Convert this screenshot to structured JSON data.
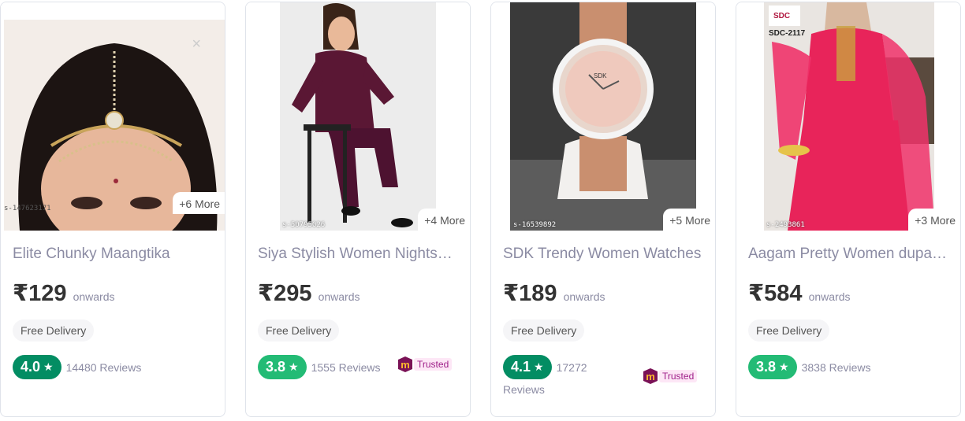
{
  "products": [
    {
      "title": "Elite Chunky Maangtika",
      "price": "₹129",
      "onwards": "onwards",
      "more": "+6 More",
      "sku": "s-147623171",
      "delivery": "Free Delivery",
      "rating": "4.0",
      "reviews": "14480 Reviews",
      "badge_color": "#038d63"
    },
    {
      "title": "Siya Stylish Women Nightsuits",
      "price": "₹295",
      "onwards": "onwards",
      "more": "+4 More",
      "sku": "s-50795026",
      "delivery": "Free Delivery",
      "rating": "3.8",
      "reviews": "1555 Reviews",
      "trusted": "Trusted",
      "badge_color": "#23bb75"
    },
    {
      "title": "SDK Trendy Women Watches",
      "price": "₹189",
      "onwards": "onwards",
      "more": "+5 More",
      "sku": "s-16539892",
      "delivery": "Free Delivery",
      "rating": "4.1",
      "reviews_line1": "17272",
      "reviews_line2": "Reviews",
      "trusted": "Trusted",
      "badge_color": "#038d63"
    },
    {
      "title": "Aagam Pretty Women dupattas",
      "price": "₹584",
      "onwards": "onwards",
      "more": "+3 More",
      "sku": "s-2493861",
      "delivery": "Free Delivery",
      "rating": "3.8",
      "reviews": "3838 Reviews",
      "badge_color": "#23bb75",
      "img_text_brand": "SDC",
      "img_text_code": "SDC-2117"
    }
  ],
  "colors": {
    "title": "#8b8ba3",
    "rating_dark": "#038d63",
    "rating_light": "#23bb75",
    "trusted": "#9f2089"
  },
  "icons": {
    "star": "star-icon",
    "trusted": "meesho-m-icon"
  }
}
